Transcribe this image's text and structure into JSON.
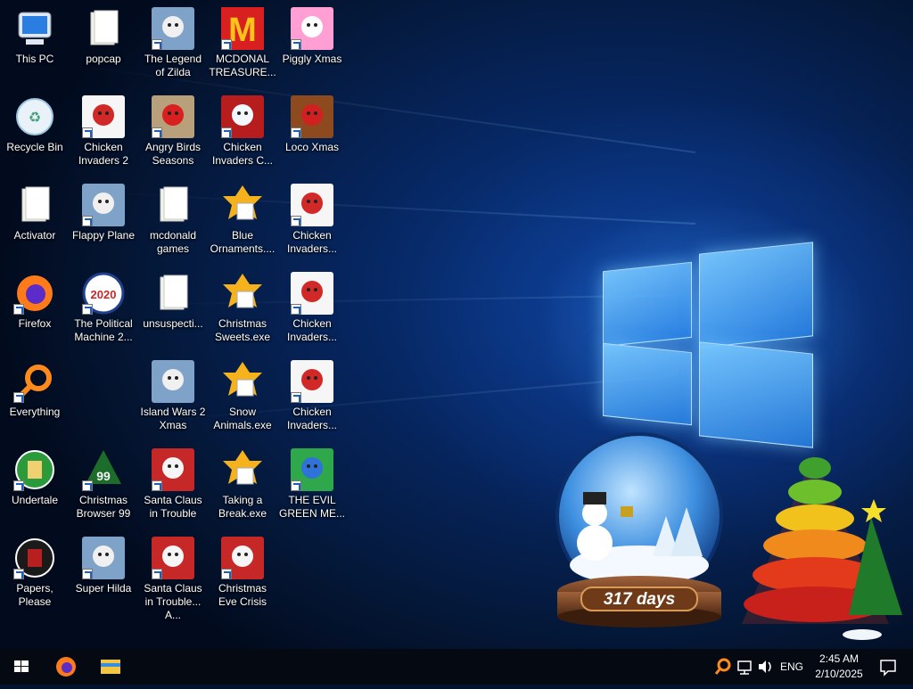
{
  "desktop": {
    "icons": [
      {
        "label": "This PC",
        "icon": "this-pc-icon",
        "shortcut": false
      },
      {
        "label": "Recycle Bin",
        "icon": "recycle-bin-icon",
        "shortcut": false
      },
      {
        "label": "Activator",
        "icon": "folder-icon",
        "shortcut": false
      },
      {
        "label": "Firefox",
        "icon": "firefox-icon",
        "shortcut": true
      },
      {
        "label": "Everything",
        "icon": "search-ring-icon",
        "shortcut": true
      },
      {
        "label": "Undertale",
        "icon": "undertale-icon",
        "shortcut": true
      },
      {
        "label": "Papers, Please",
        "icon": "papers-please-icon",
        "shortcut": true
      },
      {
        "label": "popcap",
        "icon": "folder-icon",
        "shortcut": false
      },
      {
        "label": "Chicken Invaders 2",
        "icon": "chicken-icon",
        "shortcut": true
      },
      {
        "label": "Flappy Plane",
        "icon": "game-icon",
        "shortcut": true
      },
      {
        "label": "The Political Machine 2...",
        "icon": "political-2020-icon",
        "shortcut": true
      },
      {
        "label": "Christmas Browser 99",
        "icon": "christmas-tree-icon",
        "shortcut": true
      },
      {
        "label": "Super Hilda",
        "icon": "game-icon",
        "shortcut": true
      },
      {
        "label": "The Legend of Zilda",
        "icon": "game-icon",
        "shortcut": true
      },
      {
        "label": "Angry Birds Seasons",
        "icon": "angry-birds-icon",
        "shortcut": true
      },
      {
        "label": "mcdonald games",
        "icon": "folder-icon",
        "shortcut": false
      },
      {
        "label": "unsuspecti...",
        "icon": "folder-icon",
        "shortcut": false
      },
      {
        "label": "Island Wars 2 Xmas",
        "icon": "game-icon",
        "shortcut": false
      },
      {
        "label": "Santa Claus in Trouble",
        "icon": "santa-icon",
        "shortcut": true
      },
      {
        "label": "Santa Claus in Trouble... A...",
        "icon": "santa-icon",
        "shortcut": true
      },
      {
        "label": "MCDONAL TREASURE...",
        "icon": "mcdonalds-icon",
        "shortcut": true
      },
      {
        "label": "Chicken Invaders C...",
        "icon": "snowman-icon",
        "shortcut": true
      },
      {
        "label": "Blue Ornaments....",
        "icon": "installer-icon",
        "shortcut": false
      },
      {
        "label": "Christmas Sweets.exe",
        "icon": "installer-icon",
        "shortcut": false
      },
      {
        "label": "Snow Animals.exe",
        "icon": "installer-icon",
        "shortcut": false
      },
      {
        "label": "Taking a Break.exe",
        "icon": "installer-icon",
        "shortcut": false
      },
      {
        "label": "Christmas Eve Crisis",
        "icon": "santa-icon",
        "shortcut": true
      },
      {
        "label": "Piggly Xmas",
        "icon": "pig-icon",
        "shortcut": true
      },
      {
        "label": "Loco Xmas",
        "icon": "bear-icon",
        "shortcut": true
      },
      {
        "label": "Chicken Invaders...",
        "icon": "chicken-icon",
        "shortcut": true
      },
      {
        "label": "Chicken Invaders...",
        "icon": "chicken-icon",
        "shortcut": true
      },
      {
        "label": "Chicken Invaders...",
        "icon": "chicken-icon",
        "shortcut": true
      },
      {
        "label": "THE EVIL GREEN ME...",
        "icon": "messenger-icon",
        "shortcut": true
      }
    ]
  },
  "gadget": {
    "countdown": "317 days"
  },
  "taskbar": {
    "apps": [
      {
        "name": "start",
        "icon": "windows-logo-icon"
      },
      {
        "name": "firefox",
        "icon": "firefox-icon"
      },
      {
        "name": "file-explorer",
        "icon": "folder-icon"
      }
    ],
    "tray": {
      "language": "ENG",
      "time": "2:45 AM",
      "date": "2/10/2025"
    }
  },
  "colors": {
    "accent": "#1b5fc2",
    "taskbar": "#050a12"
  }
}
